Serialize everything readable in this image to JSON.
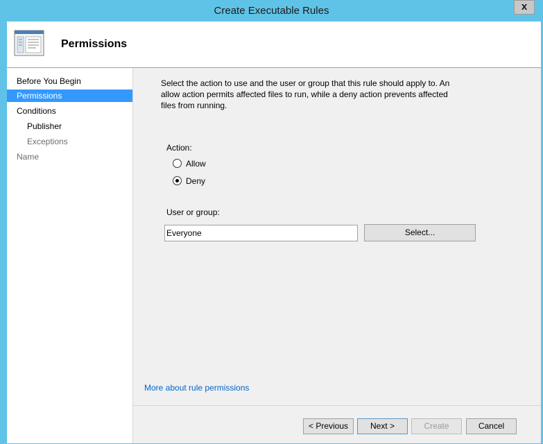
{
  "window": {
    "title": "Create Executable Rules",
    "close_glyph": "x"
  },
  "header": {
    "title": "Permissions",
    "icon": "wizard-window-icon"
  },
  "nav": {
    "items": [
      {
        "label": "Before You Begin",
        "state": "normal"
      },
      {
        "label": "Permissions",
        "state": "selected"
      },
      {
        "label": "Conditions",
        "state": "normal"
      },
      {
        "label": "Publisher",
        "state": "normal"
      },
      {
        "label": "Exceptions",
        "state": "disabled"
      },
      {
        "label": "Name",
        "state": "disabled"
      }
    ]
  },
  "content": {
    "description": "Select the action to use and the user or group that this rule should apply to. An allow action permits affected files to run, while a deny action prevents affected files from running.",
    "action_label": "Action:",
    "allow_label": "Allow",
    "deny_label": "Deny",
    "selected_action": "Deny",
    "user_group_label": "User or group:",
    "user_group_value": "Everyone",
    "select_button": "Select...",
    "help_link": "More about rule permissions"
  },
  "footer": {
    "previous": "< Previous",
    "next": "Next >",
    "create": "Create",
    "cancel": "Cancel"
  },
  "colors": {
    "title_bar": "#5fc3e8",
    "nav_selected": "#3399ff",
    "link": "#0066cc"
  }
}
